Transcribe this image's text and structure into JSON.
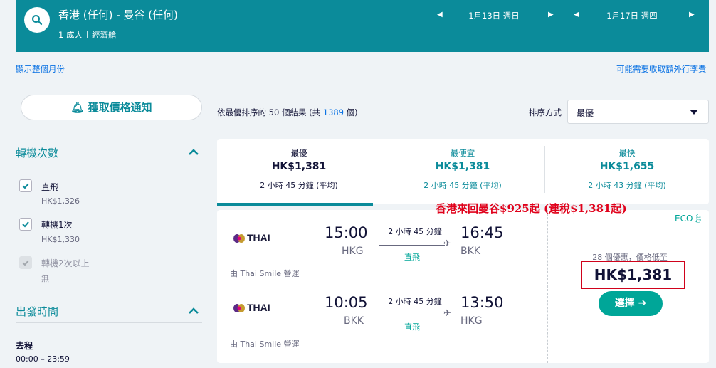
{
  "header": {
    "route": "香港 (任何) - 曼谷 (任何)",
    "passengers": "1 成人",
    "cabin": "經濟艙",
    "depart_date": "1月13日 週日",
    "return_date": "1月17日 週四"
  },
  "links": {
    "whole_month": "顯示整個月份",
    "extra_fees": "可能需要收取額外行李費"
  },
  "alert_button": "獲取價格通知",
  "filters": {
    "stops_title": "轉機次數",
    "options": [
      {
        "label": "直飛",
        "price": "HK$1,326",
        "checked": true,
        "disabled": false
      },
      {
        "label": "轉機1次",
        "price": "HK$1,330",
        "checked": true,
        "disabled": false
      },
      {
        "label": "轉機2次以上",
        "price": "無",
        "checked": true,
        "disabled": true
      }
    ],
    "departure_title": "出發時間",
    "outbound_label": "去程",
    "outbound_range": "00:00 – 23:59"
  },
  "results": {
    "prefix": "依最優排序的 50 個結果 (共 ",
    "total": "1389",
    "suffix": " 個)"
  },
  "sort": {
    "label": "排序方式",
    "value": "最優"
  },
  "tabs": [
    {
      "title": "最優",
      "price": "HK$1,381",
      "duration": "2 小時 45 分鐘 (平均)"
    },
    {
      "title": "最便宜",
      "price": "HK$1,381",
      "duration": "2 小時 45 分鐘 (平均)"
    },
    {
      "title": "最快",
      "price": "HK$1,655",
      "duration": "2 小時 43 分鐘 (平均)"
    }
  ],
  "promo": "香港來回曼谷$925起 (連稅$1,381起)",
  "card": {
    "airline": "THAI",
    "eco": "ECO",
    "legs": [
      {
        "dep_time": "15:00",
        "dep_airport": "HKG",
        "arr_time": "16:45",
        "arr_airport": "BKK",
        "duration": "2 小時 45 分鐘",
        "stops": "直飛",
        "operated_by": "由 Thai Smile 營運"
      },
      {
        "dep_time": "10:05",
        "dep_airport": "BKK",
        "arr_time": "13:50",
        "arr_airport": "HKG",
        "duration": "2 小時 45 分鐘",
        "stops": "直飛",
        "operated_by": "由 Thai Smile 營運"
      }
    ],
    "deals": "28 個優惠，價格低至",
    "price": "HK$1,381",
    "select_label": "選擇"
  },
  "colors": {
    "brand": "#0b8b9a",
    "link": "#0770e3",
    "green": "#00a698",
    "annotation": "#e0001a"
  }
}
